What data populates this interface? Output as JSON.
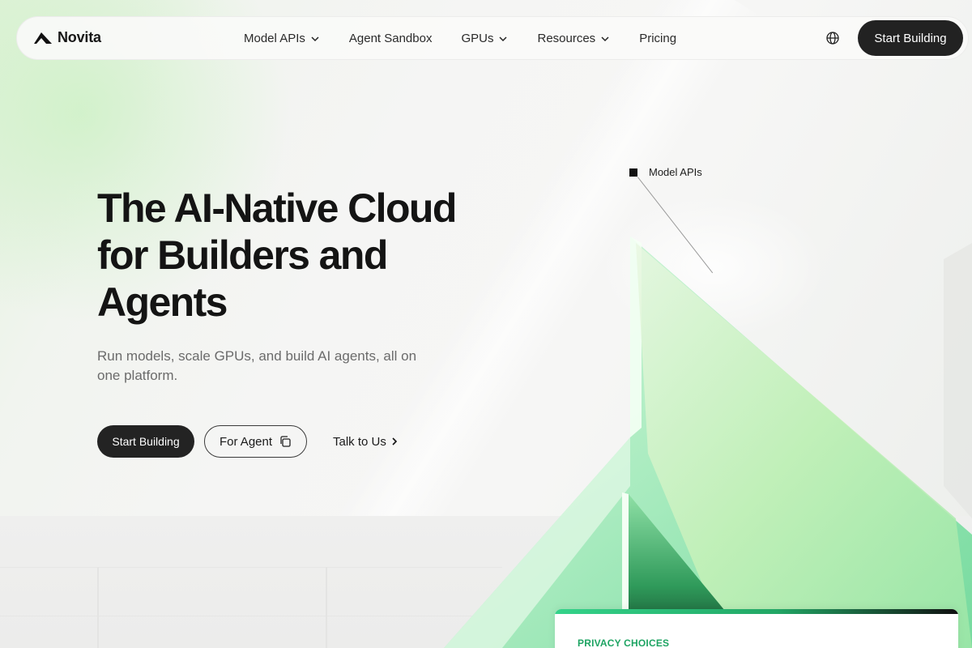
{
  "brand": {
    "name": "Novita"
  },
  "nav": {
    "items": [
      {
        "label": "Model APIs",
        "has_dropdown": true
      },
      {
        "label": "Agent Sandbox",
        "has_dropdown": false
      },
      {
        "label": "GPUs",
        "has_dropdown": true
      },
      {
        "label": "Resources",
        "has_dropdown": true
      },
      {
        "label": "Pricing",
        "has_dropdown": false
      }
    ],
    "language_icon": "globe-icon",
    "cta_label": "Start Building"
  },
  "hero": {
    "title_lines": [
      "The AI-Native Cloud",
      "for Builders and",
      "Agents"
    ],
    "subtitle": "Run models, scale GPUs, and build AI agents, all on one platform.",
    "primary_button": "Start Building",
    "secondary_button": "For Agent",
    "secondary_icon": "copy-icon",
    "link_button": "Talk to Us",
    "link_icon": "chevron-right-icon"
  },
  "visual": {
    "tag_label": "Model APIs",
    "accent_green": "#7fe0a0",
    "dark_green": "#1f7a43"
  },
  "privacy_banner": {
    "title": "PRIVACY CHOICES",
    "accent": "#1ea463"
  }
}
